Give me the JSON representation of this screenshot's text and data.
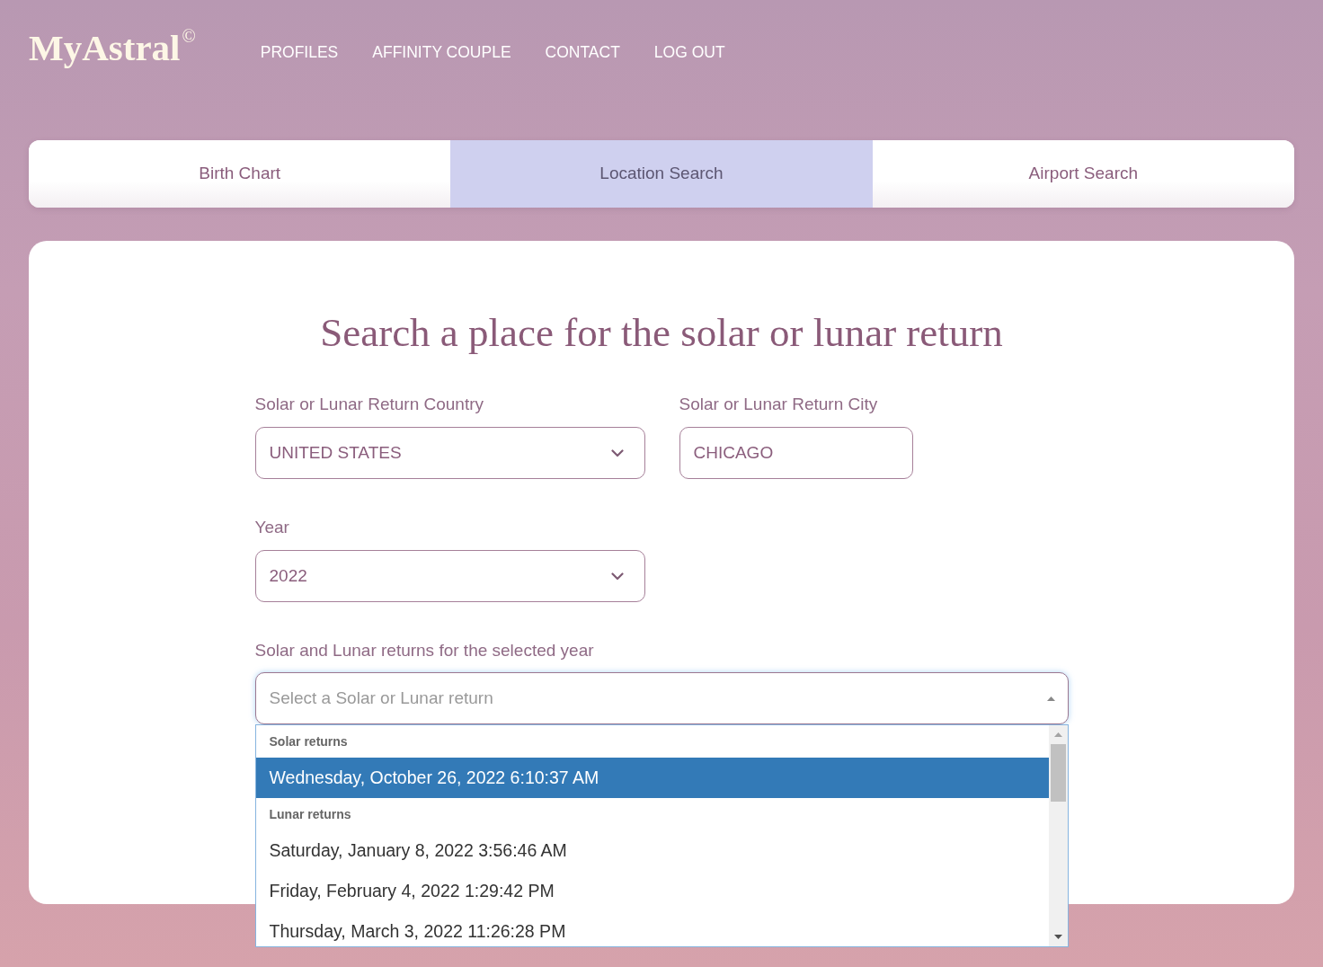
{
  "header": {
    "logo": "MyAstral",
    "logo_mark": "©",
    "nav": [
      "PROFILES",
      "AFFINITY COUPLE",
      "CONTACT",
      "LOG OUT"
    ]
  },
  "tabs": [
    {
      "label": "Birth Chart",
      "selected": false
    },
    {
      "label": "Location Search",
      "selected": true
    },
    {
      "label": "Airport Search",
      "selected": false
    }
  ],
  "form": {
    "title": "Search a place for the solar or lunar return",
    "field_rows": [
      [
        {
          "kind": "select",
          "label": "Solar or Lunar Return Country",
          "value": "UNITED STATES"
        },
        {
          "kind": "text",
          "label": "Solar or Lunar Return City",
          "value": "CHICAGO"
        }
      ],
      [
        {
          "kind": "select",
          "label": "Year",
          "value": "2022"
        }
      ]
    ],
    "returns": {
      "label": "Solar and Lunar returns for the selected year",
      "placeholder": "Select a Solar or Lunar return",
      "expanded": true,
      "groups": [
        {
          "label": "Solar returns",
          "options": [
            {
              "label": "Wednesday, October 26, 2022 6:10:37 AM",
              "selected": true
            }
          ]
        },
        {
          "label": "Lunar returns",
          "options": [
            {
              "label": "Saturday, January 8, 2022 3:56:46 AM",
              "selected": false
            },
            {
              "label": "Friday, February 4, 2022 1:29:42 PM",
              "selected": false
            },
            {
              "label": "Thursday, March 3, 2022 11:26:28 PM",
              "selected": false
            }
          ]
        }
      ]
    }
  }
}
